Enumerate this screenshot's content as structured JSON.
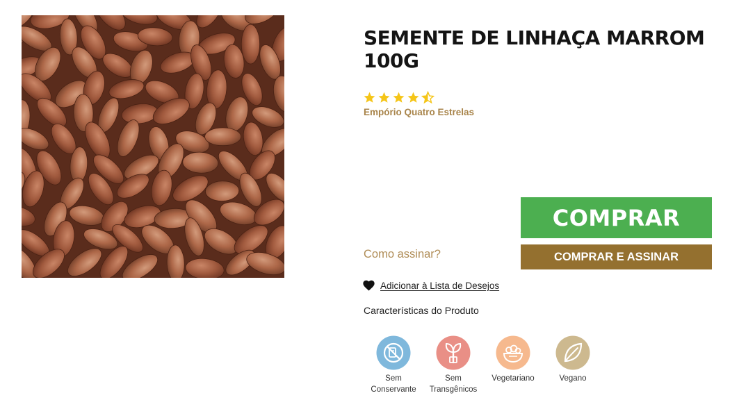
{
  "product": {
    "title": "SEMENTE DE LINHAÇA MARROM 100G",
    "brand": "Empório Quatro Estrelas",
    "rating": 4.5,
    "image_alt_icon": "flaxseed-photo"
  },
  "actions": {
    "buy_label": "COMPRAR",
    "buy_and_subscribe_label": "COMPRAR E ASSINAR",
    "how_to_subscribe_label": "Como assinar?",
    "wishlist_label": "Adicionar à Lista de Desejos"
  },
  "features": {
    "title": "Características do Produto",
    "items": [
      {
        "label": "Sem\nConservante",
        "icon": "no-preservatives-icon",
        "color": "#7fb8dc"
      },
      {
        "label": "Sem\nTransgênicos",
        "icon": "sprout-icon",
        "color": "#e98f86"
      },
      {
        "label": "Vegetariano",
        "icon": "salad-bowl-icon",
        "color": "#f6b98e"
      },
      {
        "label": "Vegano",
        "icon": "leaf-icon",
        "color": "#cdb98f"
      }
    ]
  },
  "colors": {
    "buy_button": "#4caf50",
    "subscribe_button": "#94702f",
    "brand_text": "#a8844a",
    "star": "#f5c518"
  }
}
